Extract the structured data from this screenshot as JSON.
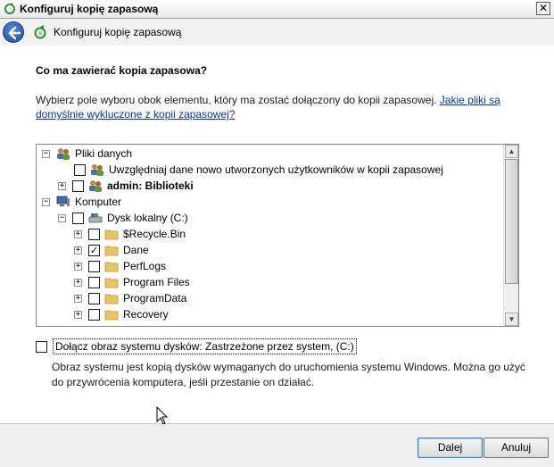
{
  "window": {
    "title": "Konfiguruj kopię zapasową",
    "close_glyph": "✕"
  },
  "nav": {
    "title": "Konfiguruj kopię zapasową"
  },
  "content": {
    "heading": "Co ma zawierać kopia zapasowa?",
    "description": "Wybierz pole wyboru obok elementu, który ma zostać dołączony do kopii zapasowej. ",
    "link": "Jakie pliki są domyślnie wykluczone z kopii zapasowej?"
  },
  "tree": {
    "items": [
      {
        "label": "Pliki danych",
        "expander": "⊟",
        "checkbox": false,
        "icon": "users-icon"
      },
      {
        "label": "Uwzględniaj dane nowo utworzonych użytkowników w kopii zapasowej",
        "checkbox": "unchecked",
        "icon": "users-icon"
      },
      {
        "label": "admin: Biblioteki",
        "expander": "+",
        "checkbox": "unchecked",
        "icon": "users-icon"
      },
      {
        "label": "Komputer",
        "expander": "−",
        "checkbox": false,
        "icon": "computer-icon"
      },
      {
        "label": "Dysk lokalny (C:)",
        "expander": "−",
        "checkbox": "unchecked",
        "icon": "drive-icon"
      },
      {
        "label": "$Recycle.Bin",
        "expander": "+",
        "checkbox": "unchecked",
        "icon": "folder-icon"
      },
      {
        "label": "Dane",
        "expander": "+",
        "checkbox": "checked",
        "icon": "folder-icon"
      },
      {
        "label": "PerfLogs",
        "expander": "+",
        "checkbox": "unchecked",
        "icon": "folder-icon"
      },
      {
        "label": "Program Files",
        "expander": "+",
        "checkbox": "unchecked",
        "icon": "folder-icon"
      },
      {
        "label": "ProgramData",
        "expander": "+",
        "checkbox": "unchecked",
        "icon": "folder-icon"
      },
      {
        "label": "Recovery",
        "expander": "+",
        "checkbox": "unchecked",
        "icon": "folder-icon"
      }
    ],
    "check_glyph": "✓"
  },
  "system_image": {
    "label": "Dołącz obraz systemu dysków: Zastrzeżone przez system, (C:)",
    "checked": false,
    "description": "Obraz systemu jest kopią dysków wymaganych do uruchomienia systemu Windows. Można go użyć do przywrócenia komputera, jeśli przestanie on działać."
  },
  "buttons": {
    "next": "Dalej",
    "cancel": "Anuluj"
  },
  "colors": {
    "link": "#0033cc",
    "folder": "#e8c560",
    "accent": "#1c4f9c"
  }
}
